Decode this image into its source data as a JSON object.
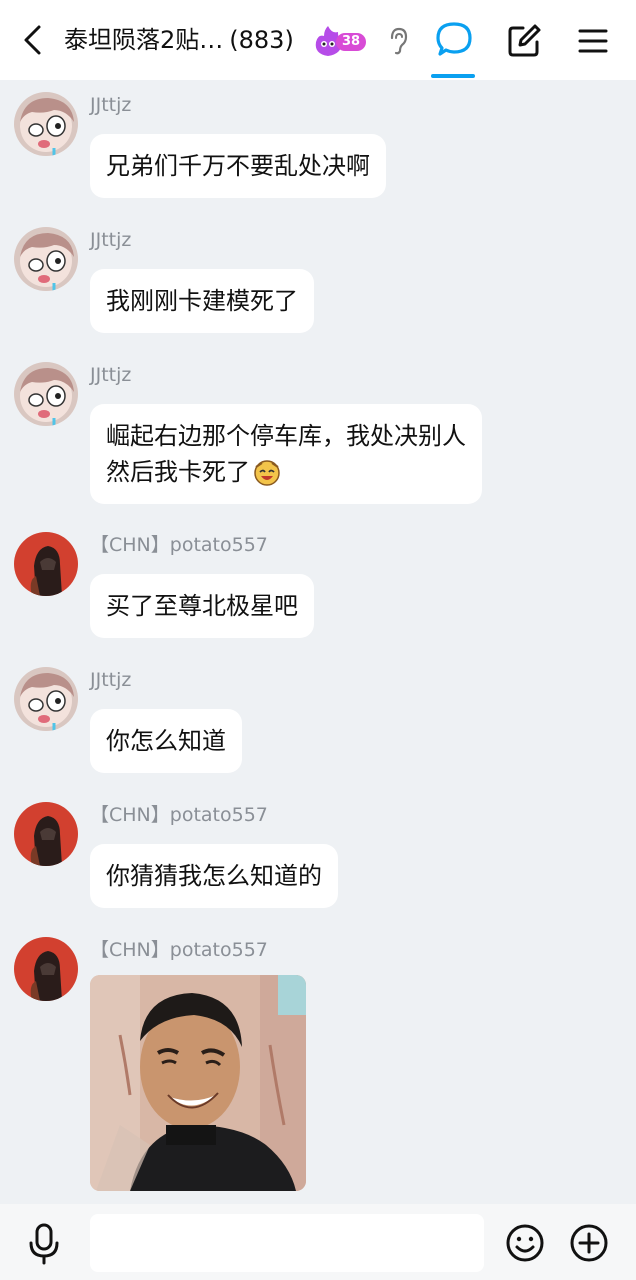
{
  "header": {
    "title": "泰坦陨落2贴…",
    "member_count": "(883)",
    "level_badge": "38",
    "colors": {
      "accent": "#0aa0f0",
      "badge": "#d84bd6"
    }
  },
  "messages": [
    {
      "sender": "JJttjz",
      "avatar": "cartoon-girl-avatar",
      "text": "兄弟们千万不要乱处决啊"
    },
    {
      "sender": "JJttjz",
      "avatar": "cartoon-girl-avatar",
      "text": "我刚刚卡建模死了"
    },
    {
      "sender": "JJttjz",
      "avatar": "cartoon-girl-avatar",
      "line1": "崛起右边那个停车库，我处决别人",
      "line2": "然后我卡死了"
    },
    {
      "sender": "【CHN】potato557",
      "avatar": "dark-helmet-avatar",
      "text": "买了至尊北极星吧"
    },
    {
      "sender": "JJttjz",
      "avatar": "cartoon-girl-avatar",
      "text": "你怎么知道"
    },
    {
      "sender": "【CHN】potato557",
      "avatar": "dark-helmet-avatar",
      "text": "你猜猜我怎么知道的"
    },
    {
      "sender": "【CHN】potato557",
      "avatar": "dark-helmet-avatar",
      "image": "smiling-man-photo"
    }
  ],
  "input": {
    "placeholder": ""
  }
}
